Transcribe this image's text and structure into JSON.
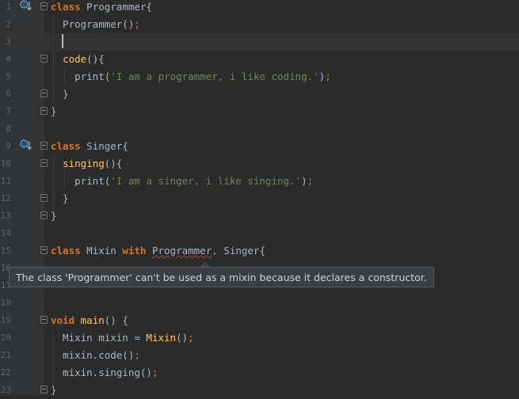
{
  "editor": {
    "lines": [
      {
        "number": "1",
        "parts": [
          {
            "t": "class",
            "c": "kw"
          },
          {
            "t": " Programmer{",
            "c": ""
          }
        ]
      },
      {
        "number": "2",
        "parts": [
          {
            "t": "  Programmer();",
            "c": "ctor"
          }
        ]
      },
      {
        "number": "3",
        "parts": []
      },
      {
        "number": "4",
        "parts": [
          {
            "t": "  ",
            "c": ""
          },
          {
            "t": "code",
            "c": "fn"
          },
          {
            "t": "(){",
            "c": ""
          }
        ]
      },
      {
        "number": "5",
        "parts": [
          {
            "t": "    print(",
            "c": ""
          },
          {
            "t": "'I am a programmer, i like coding.'",
            "c": "str"
          },
          {
            "t": ")",
            "c": ""
          },
          {
            "t": ";",
            "c": "semi"
          }
        ]
      },
      {
        "number": "6",
        "parts": [
          {
            "t": "  }",
            "c": ""
          }
        ]
      },
      {
        "number": "7",
        "parts": [
          {
            "t": "}",
            "c": ""
          }
        ]
      },
      {
        "number": "8",
        "parts": []
      },
      {
        "number": "9",
        "parts": [
          {
            "t": "class",
            "c": "kw"
          },
          {
            "t": " Singer{",
            "c": ""
          }
        ]
      },
      {
        "number": "10",
        "parts": [
          {
            "t": "  ",
            "c": ""
          },
          {
            "t": "singing",
            "c": "fn"
          },
          {
            "t": "(){",
            "c": ""
          }
        ]
      },
      {
        "number": "11",
        "parts": [
          {
            "t": "    print(",
            "c": ""
          },
          {
            "t": "'I am a singer, i like singing.'",
            "c": "str"
          },
          {
            "t": ")",
            "c": ""
          },
          {
            "t": ";",
            "c": "semi"
          }
        ]
      },
      {
        "number": "12",
        "parts": [
          {
            "t": "  }",
            "c": ""
          }
        ]
      },
      {
        "number": "13",
        "parts": [
          {
            "t": "}",
            "c": ""
          }
        ]
      },
      {
        "number": "14",
        "parts": []
      },
      {
        "number": "15",
        "parts": [
          {
            "t": "class",
            "c": "kw"
          },
          {
            "t": " Mixin ",
            "c": ""
          },
          {
            "t": "with",
            "c": "kw"
          },
          {
            "t": " ",
            "c": ""
          },
          {
            "t": "Programmer",
            "c": "err"
          },
          {
            "t": ",",
            "c": "semi"
          },
          {
            "t": " Singer{",
            "c": ""
          }
        ]
      },
      {
        "number": "16",
        "parts": []
      },
      {
        "number": "17",
        "parts": []
      },
      {
        "number": "18",
        "parts": []
      },
      {
        "number": "19",
        "parts": [
          {
            "t": "void",
            "c": "kw"
          },
          {
            "t": " ",
            "c": ""
          },
          {
            "t": "main",
            "c": "fn"
          },
          {
            "t": "() {",
            "c": ""
          }
        ]
      },
      {
        "number": "20",
        "parts": [
          {
            "t": "  Mixin mixin = ",
            "c": ""
          },
          {
            "t": "Mixin",
            "c": "fn"
          },
          {
            "t": "()",
            "c": ""
          },
          {
            "t": ";",
            "c": "semi"
          }
        ]
      },
      {
        "number": "21",
        "parts": [
          {
            "t": "  mixin.code()",
            "c": ""
          },
          {
            "t": ";",
            "c": "semi"
          }
        ]
      },
      {
        "number": "22",
        "parts": [
          {
            "t": "  mixin.singing()",
            "c": ""
          },
          {
            "t": ";",
            "c": "semi"
          }
        ]
      },
      {
        "number": "23",
        "parts": [
          {
            "t": "}",
            "c": ""
          }
        ]
      }
    ],
    "current_line": "3"
  },
  "tooltip": {
    "message": "The class 'Programmer' can't be used as a mixin because it declares a constructor."
  },
  "colors": {
    "background": "#2b2b2b",
    "keyword": "#cc7832",
    "function": "#ffc66d",
    "string": "#6a8759",
    "text": "#a9b7c6",
    "error_underline": "#bc3f3c"
  },
  "icons": {
    "implementation_markers": [
      "override-down-arrow-icon",
      "override-down-arrow-icon"
    ]
  }
}
